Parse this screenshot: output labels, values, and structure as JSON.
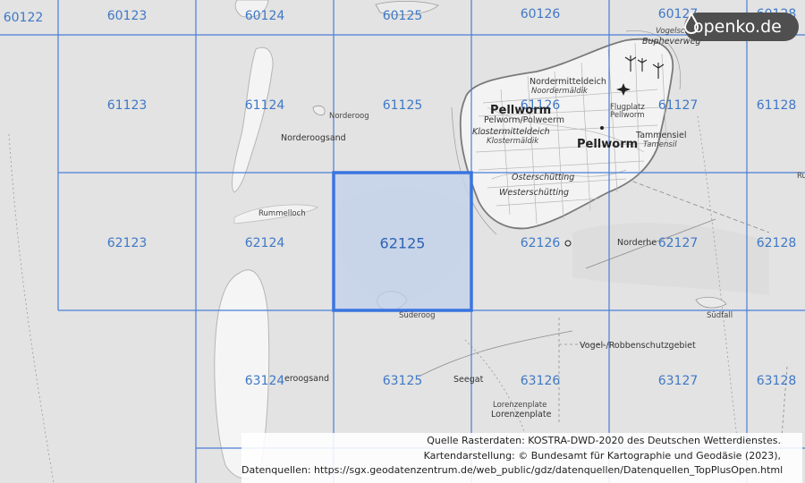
{
  "map": {
    "grid_labels": [
      "60122",
      "60123",
      "60124",
      "60125",
      "60126",
      "60127",
      "60128",
      "61123",
      "61124",
      "61125",
      "61126",
      "61127",
      "61128",
      "62123",
      "62124",
      "62125",
      "62126",
      "62127",
      "62128",
      "63124",
      "63125",
      "63126",
      "63127",
      "63128"
    ],
    "highlighted_cell": "62125",
    "places": {
      "pellworm_top": "Pellworm",
      "pellworm_alt": "Pelworm/Polweerm",
      "pellworm_town": "Pellworm",
      "nordermitteldeich": "Nordermitteldeich",
      "nordermitteldeich_alt": "Noordermäldik",
      "klostermitteldeich": "Klostermitteldeich",
      "klostermitteldeich_alt": "Klostermäldik",
      "flugplatz": "Flugplatz",
      "flugplatz_2": "Pellworm",
      "tammensiel": "Tammensiel",
      "tammensiel_alt": "Tamensil",
      "ostersch": "Osterschütting",
      "westersch": "Westerschütting",
      "vogelsch": "Vogelsch",
      "bupheverweg": "Bupheverweg",
      "norderoog": "Norderoog",
      "norderoogsand": "Norderoogsand",
      "rummelloch": "Rummelloch",
      "suederoog": "Süderoog",
      "norderhe": "Norderhe",
      "suedfall": "Südfall",
      "vogel_robben": "Vogel-/Robbenschutzgebiet",
      "seegat": "Seegat",
      "eroogsand": "eroogsand",
      "lorenzenplate": "Lorenzenplate",
      "lorenzenplate_small": "Lorenzenplate",
      "edge_ru": "Ru"
    }
  },
  "logo": {
    "text": "openko.de"
  },
  "attribution": {
    "line1": "Quelle Rasterdaten: KOSTRA-DWD-2020 des Deutschen Wetterdienstes.",
    "line2": "Kartendarstellung: © Bundesamt für Kartographie und Geodäsie (2023),",
    "line3": "Datenquellen: https://sgx.geodatenzentrum.de/web_public/gdz/datenquellen/Datenquellen_TopPlusOpen.html"
  },
  "colors": {
    "grid": "#4a7fd6",
    "highlight_fill": "#c3d2ea",
    "highlight_stroke": "#3a74e0",
    "water": "#e3e3e3",
    "land": "#f6f6f6"
  }
}
